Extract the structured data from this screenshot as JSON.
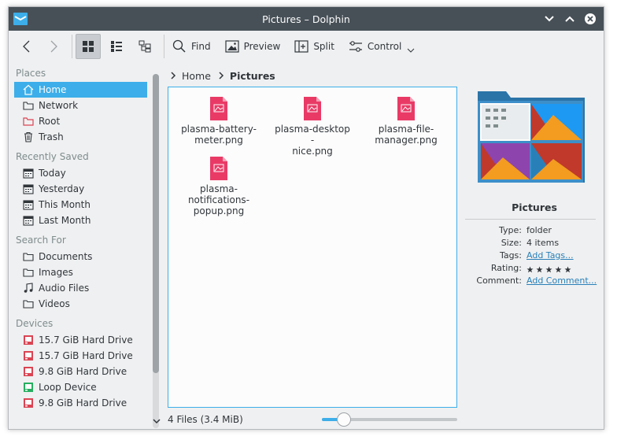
{
  "window": {
    "title": "Pictures – Dolphin",
    "title_color": "#475057"
  },
  "toolbar": {
    "find_label": "Find",
    "preview_label": "Preview",
    "split_label": "Split",
    "control_label": "Control"
  },
  "sidebar": {
    "places_title": "Places",
    "places": [
      {
        "label": "Home",
        "icon": "home-icon"
      },
      {
        "label": "Network",
        "icon": "network-icon"
      },
      {
        "label": "Root",
        "icon": "root-folder-icon"
      },
      {
        "label": "Trash",
        "icon": "trash-icon"
      }
    ],
    "recent_title": "Recently Saved",
    "recent": [
      {
        "label": "Today",
        "icon": "calendar-icon"
      },
      {
        "label": "Yesterday",
        "icon": "calendar-icon"
      },
      {
        "label": "This Month",
        "icon": "calendar-icon"
      },
      {
        "label": "Last Month",
        "icon": "calendar-icon"
      }
    ],
    "search_title": "Search For",
    "search": [
      {
        "label": "Documents",
        "icon": "folder-icon"
      },
      {
        "label": "Images",
        "icon": "folder-icon"
      },
      {
        "label": "Audio Files",
        "icon": "music-icon"
      },
      {
        "label": "Videos",
        "icon": "folder-icon"
      }
    ],
    "devices_title": "Devices",
    "devices": [
      {
        "label": "15.7 GiB Hard Drive",
        "icon": "hard-drive-icon"
      },
      {
        "label": "15.7 GiB Hard Drive",
        "icon": "hard-drive-icon"
      },
      {
        "label": "9.8 GiB Hard Drive",
        "icon": "hard-drive-icon"
      },
      {
        "label": "Loop Device",
        "icon": "loop-device-icon"
      },
      {
        "label": "9.8 GiB Hard Drive",
        "icon": "hard-drive-icon"
      }
    ],
    "accent": "#3daee9"
  },
  "breadcrumb": {
    "home": "Home",
    "current": "Pictures"
  },
  "files": [
    {
      "name": "plasma-battery-meter.png",
      "line1": "plasma-battery-",
      "line2": "meter.png",
      "line3": ""
    },
    {
      "name": "plasma-desktop-nice.png",
      "line1": "plasma-desktop-",
      "line2": "nice.png",
      "line3": ""
    },
    {
      "name": "plasma-file-manager.png",
      "line1": "plasma-file-",
      "line2": "manager.png",
      "line3": ""
    },
    {
      "name": "plasma-notifications-popup.png",
      "line1": "plasma-",
      "line2": "notifications-",
      "line3": "popup.png"
    }
  ],
  "status": {
    "text": "4 Files (3.4 MiB)",
    "zoom_fraction": 0.16
  },
  "info": {
    "name": "Pictures",
    "type_key": "Type:",
    "type_value": "folder",
    "size_key": "Size:",
    "size_value": "4 items",
    "tags_key": "Tags:",
    "tags_value": "Add Tags...",
    "rating_key": "Rating:",
    "rating_value": 0,
    "comment_key": "Comment:",
    "comment_value": "Add Comment..."
  },
  "colors": {
    "file_icon": "#e93a66",
    "link": "#2980b9"
  }
}
